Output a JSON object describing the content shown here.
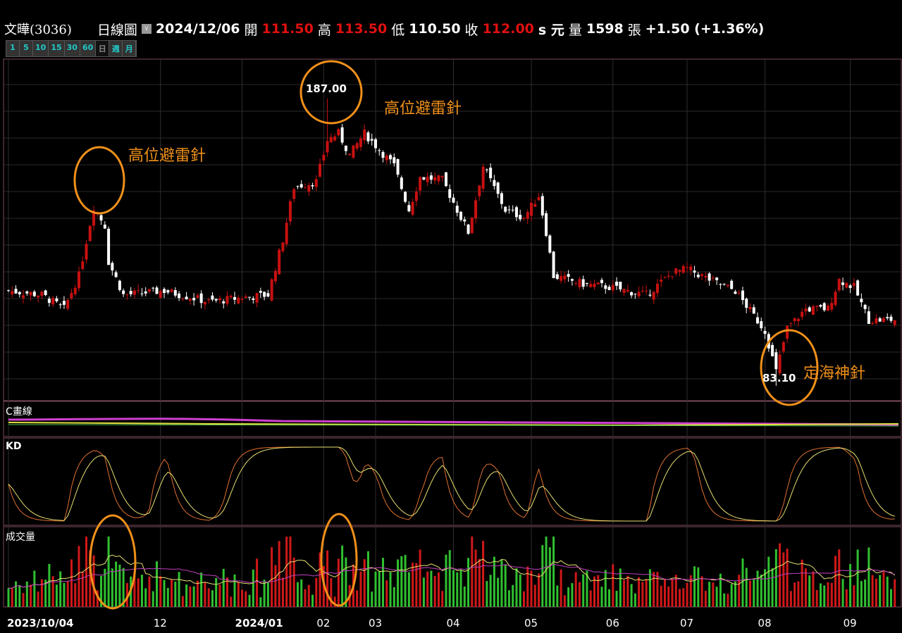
{
  "header": {
    "name": "文曄(3036)",
    "period": "日線圖",
    "date": "2024/12/06",
    "open_label": "開",
    "open": "111.50",
    "high_label": "高",
    "high": "113.50",
    "low_label": "低",
    "low": "110.50",
    "close_label": "收",
    "close": "112.00",
    "unit": "s 元",
    "vol_label": "量",
    "volume": "1598",
    "vol_unit": "張",
    "change": "+1.50 (+1.36%)"
  },
  "period_buttons": [
    "1",
    "5",
    "10",
    "15",
    "30",
    "60",
    "日",
    "週",
    "月"
  ],
  "panels": {
    "c_line": "C畫線",
    "kd": "KD",
    "volume": "成交量"
  },
  "annotations": {
    "top1": "高位避雷針",
    "top2": "高位避雷針",
    "bottom": "定海神針",
    "peak": "187.00",
    "trough": "83.10"
  },
  "colors": {
    "up": "#c81010",
    "down": "#ffffff",
    "annotation": "#f0901a",
    "k": "#e07030",
    "d": "#e8e070",
    "vol_up": "#d01818",
    "vol_down": "#30c030"
  },
  "chart_data": {
    "type": "candlestick",
    "title": "文曄(3036) 日線圖",
    "x_ticks": [
      {
        "label": "2023/10/04",
        "day": 0
      },
      {
        "label": "12",
        "day": 41
      },
      {
        "label": "2024/01",
        "day": 63
      },
      {
        "label": "02",
        "day": 85
      },
      {
        "label": "03",
        "day": 99
      },
      {
        "label": "04",
        "day": 120
      },
      {
        "label": "05",
        "day": 141
      },
      {
        "label": "06",
        "day": 163
      },
      {
        "label": "07",
        "day": 183
      },
      {
        "label": "08",
        "day": 204
      },
      {
        "label": "09",
        "day": 227
      }
    ],
    "price_range": [
      78,
      201
    ],
    "close_path": [
      [
        0,
        117.5
      ],
      [
        9,
        116
      ],
      [
        15,
        111
      ],
      [
        19,
        123
      ],
      [
        23,
        148
      ],
      [
        26,
        141
      ],
      [
        27,
        128
      ],
      [
        31,
        116
      ],
      [
        42,
        117.5
      ],
      [
        54,
        113.5
      ],
      [
        63,
        115
      ],
      [
        70,
        116
      ],
      [
        74,
        136
      ],
      [
        77,
        155
      ],
      [
        83,
        157
      ],
      [
        86,
        172
      ],
      [
        89,
        174.5
      ],
      [
        92,
        166.6
      ],
      [
        96,
        174.5
      ],
      [
        104,
        162.6
      ],
      [
        108,
        146.7
      ],
      [
        111,
        158.6
      ],
      [
        117,
        157.6
      ],
      [
        122,
        144
      ],
      [
        124,
        138.7
      ],
      [
        128,
        162.6
      ],
      [
        134,
        146.7
      ],
      [
        139,
        144
      ],
      [
        143,
        152
      ],
      [
        145,
        138.7
      ],
      [
        147,
        122.8
      ],
      [
        155,
        120
      ],
      [
        162,
        118.8
      ],
      [
        172,
        116
      ],
      [
        179,
        124
      ],
      [
        183,
        125.5
      ],
      [
        189,
        121.5
      ],
      [
        196,
        117.5
      ],
      [
        204,
        103
      ],
      [
        207,
        88.3
      ],
      [
        210,
        104
      ],
      [
        215,
        110.9
      ],
      [
        221,
        111
      ],
      [
        224,
        121.5
      ],
      [
        228,
        118.8
      ],
      [
        232,
        106.9
      ],
      [
        239,
        107
      ]
    ],
    "peak": {
      "day": 86,
      "high": 187.0
    },
    "trough": {
      "day": 207,
      "low": 83.1
    },
    "total_days": 240
  }
}
